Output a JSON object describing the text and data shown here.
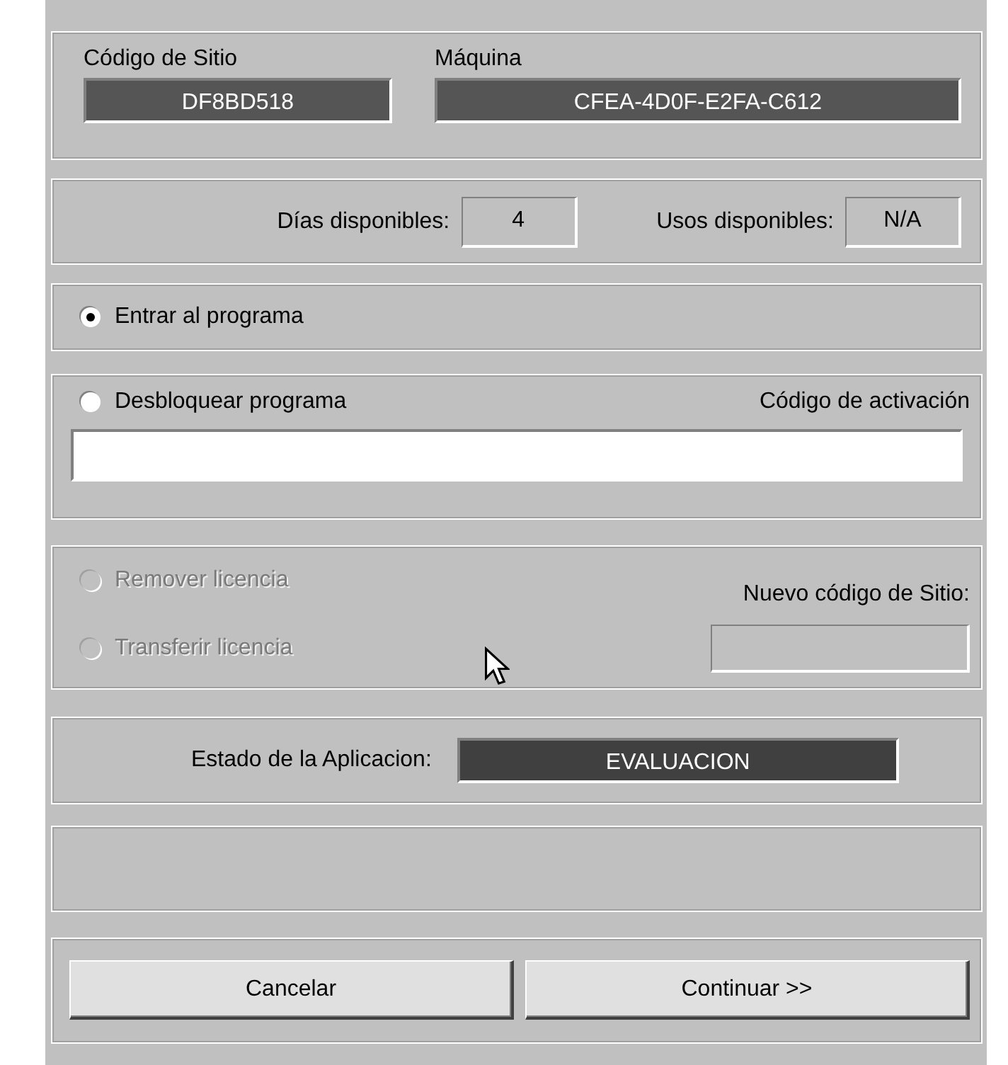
{
  "site_code": {
    "label": "Código de Sitio",
    "value": "DF8BD518"
  },
  "machine": {
    "label": "Máquina",
    "value": "CFEA-4D0F-E2FA-C612"
  },
  "days": {
    "label": "Días disponibles:",
    "value": "4"
  },
  "uses": {
    "label": "Usos disponibles:",
    "value": "N/A"
  },
  "enter_option": {
    "label": "Entrar al programa",
    "selected": true,
    "disabled": false
  },
  "unlock_panel": {
    "option": {
      "label": "Desbloquear programa",
      "selected": false,
      "disabled": false
    },
    "activation_label": "Código de activación"
  },
  "license_panel": {
    "options": [
      {
        "label": "Remover licencia",
        "selected": false,
        "disabled": true
      },
      {
        "label": "Transferir licencia",
        "selected": false,
        "disabled": true
      }
    ],
    "new_site_code_label": "Nuevo código de Sitio:",
    "new_site_code_disabled": true
  },
  "status": {
    "label": "Estado de la Aplicacion:",
    "value": "EVALUACION"
  },
  "buttons": [
    {
      "label": "Cancelar"
    },
    {
      "label": "Continuar >>"
    }
  ]
}
